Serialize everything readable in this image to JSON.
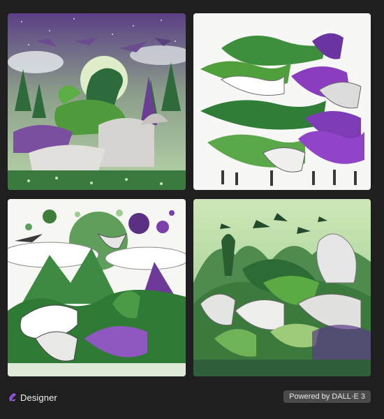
{
  "gallery": {
    "images": [
      {
        "scene": "dinosaurs-night-forest"
      },
      {
        "scene": "dinosaur-herd-white-background"
      },
      {
        "scene": "dinosaurs-coloring-style-purple-sun"
      },
      {
        "scene": "dinosaurs-green-jungle-valley"
      }
    ]
  },
  "footer": {
    "brand_label": "Designer",
    "brand_icon": "designer-logo-icon",
    "powered_label": "Powered by DALL·E 3"
  },
  "colors": {
    "background": "#1f1f1f",
    "badge_background": "#4a4a4a",
    "brand_purple": "#8b4fd6",
    "dino_green": "#4f9a3a",
    "dino_purple": "#7a3fa8"
  }
}
